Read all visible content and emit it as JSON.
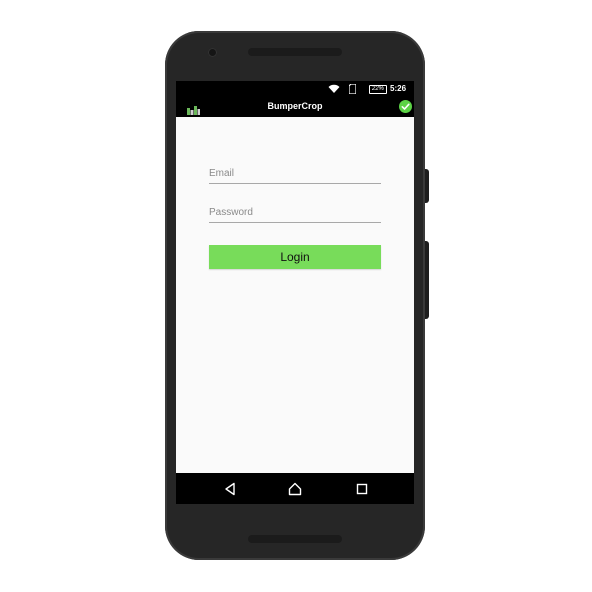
{
  "status_bar": {
    "battery_label": "22%",
    "time": "5:26"
  },
  "app_bar": {
    "title": "BumperCrop",
    "check_color": "#5cd346"
  },
  "form": {
    "email_placeholder": "Email",
    "password_placeholder": "Password",
    "login_label": "Login",
    "accent": "#78dc5a"
  },
  "icons": [
    "wifi-icon",
    "sim-card-icon",
    "battery-icon",
    "app-logo-icon",
    "check-circle-icon",
    "back-icon",
    "home-icon",
    "recents-icon"
  ]
}
